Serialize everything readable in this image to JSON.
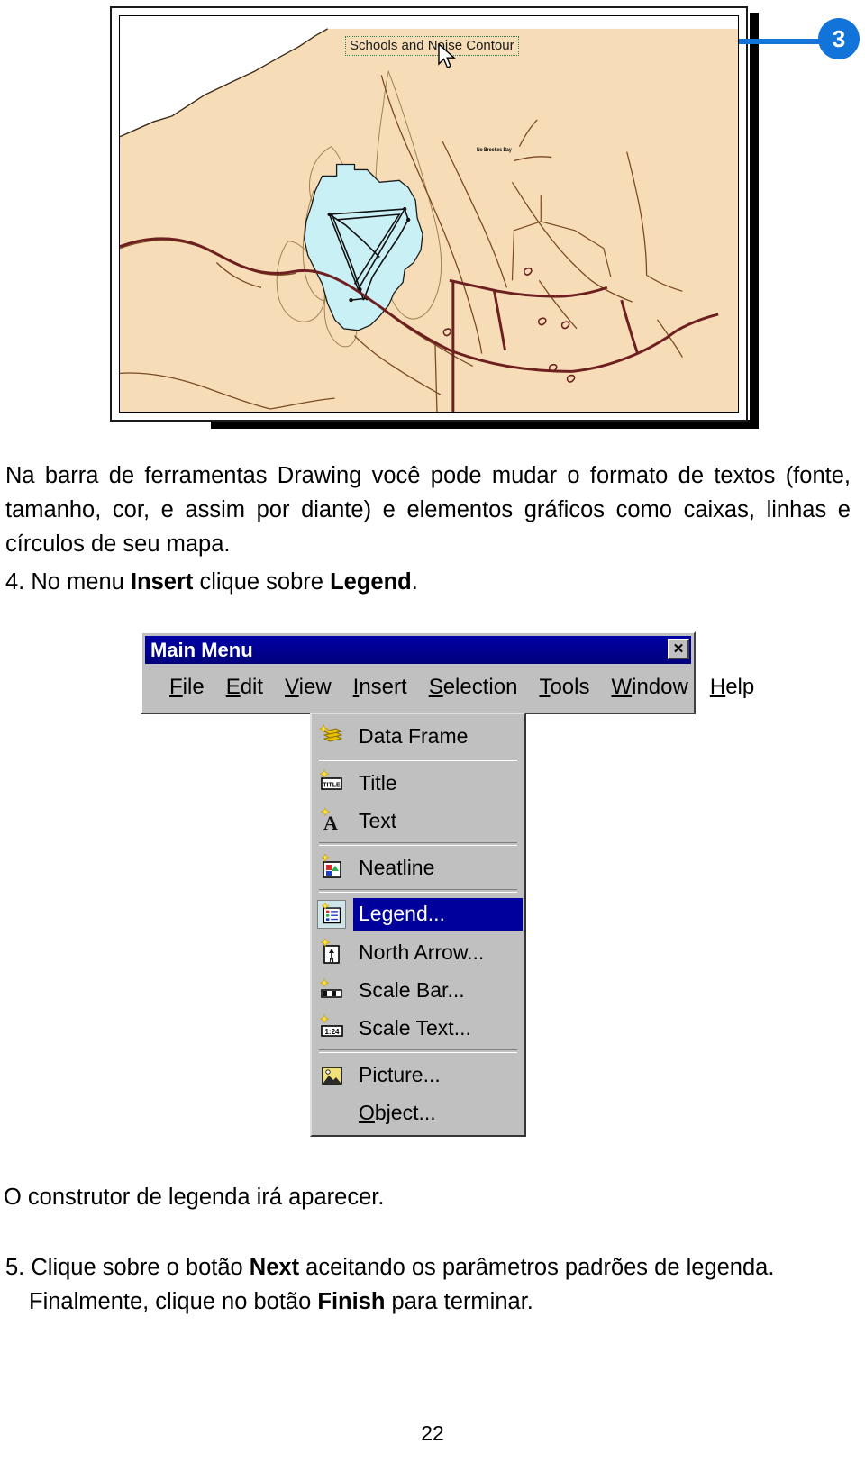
{
  "figure": {
    "map_title": "Schools and Noise Contour",
    "place_label": "No Brookes Bay",
    "callout_number": "3",
    "colors": {
      "land": "#f6ddb8",
      "noise_polygon": "#c9f0f5",
      "road_major": "#7a2020",
      "road_minor": "#8a5a3a",
      "callout_blue": "#1273d8",
      "title_box_border": "#2e7d4f"
    }
  },
  "body": {
    "intro_paragraph_lines": [
      "Na barra de ferramentas Drawing você pode mudar o formato de textos",
      "(fonte, tamanho, cor, e assim por diante) e elementos gráficos como caixas,",
      "linhas e círculos de seu mapa."
    ],
    "step_4": {
      "number": "4.",
      "text_before": "No menu ",
      "bold_1": "Insert",
      "text_middle": " clique sobre ",
      "bold_2": "Legend",
      "text_after": "."
    },
    "constructor_line": "O construtor de legenda irá aparecer.",
    "step_5": {
      "number": "5.",
      "text_1": "Clique sobre o botão ",
      "bold_1": "Next",
      "text_2": " aceitando os parâmetros padrões de legenda.",
      "text_3": "Finalmente, clique no botão ",
      "bold_2": "Finish",
      "text_4": " para terminar."
    },
    "page_number": "22"
  },
  "menu_window": {
    "title": "Main Menu",
    "close_label": "✕",
    "menubar": [
      {
        "name": "file",
        "pre": "",
        "mnemonic": "F",
        "post": "ile"
      },
      {
        "name": "edit",
        "pre": "",
        "mnemonic": "E",
        "post": "dit"
      },
      {
        "name": "view",
        "pre": "",
        "mnemonic": "V",
        "post": "iew"
      },
      {
        "name": "insert",
        "pre": "",
        "mnemonic": "I",
        "post": "nsert"
      },
      {
        "name": "selection",
        "pre": "",
        "mnemonic": "S",
        "post": "election"
      },
      {
        "name": "tools",
        "pre": "",
        "mnemonic": "T",
        "post": "ools"
      },
      {
        "name": "window",
        "pre": "",
        "mnemonic": "W",
        "post": "indow"
      },
      {
        "name": "help",
        "pre": "",
        "mnemonic": "H",
        "post": "elp"
      }
    ]
  },
  "insert_menu": {
    "items": [
      {
        "label": "Data Frame",
        "icon": "data-frame-icon",
        "selected": false,
        "separator_after": true
      },
      {
        "label": "Title",
        "icon": "title-icon",
        "selected": false,
        "separator_after": false
      },
      {
        "label": "Text",
        "icon": "text-icon",
        "selected": false,
        "separator_after": true
      },
      {
        "label": "Neatline",
        "icon": "neatline-icon",
        "selected": false,
        "separator_after": true
      },
      {
        "label": "Legend...",
        "icon": "legend-icon",
        "selected": true,
        "separator_after": false
      },
      {
        "label": "North Arrow...",
        "icon": "north-arrow-icon",
        "selected": false,
        "separator_after": false
      },
      {
        "label": "Scale Bar...",
        "icon": "scale-bar-icon",
        "selected": false,
        "separator_after": false
      },
      {
        "label": "Scale Text...",
        "icon": "scale-text-icon",
        "selected": false,
        "separator_after": true
      },
      {
        "label": "Picture...",
        "icon": "picture-icon",
        "selected": false,
        "separator_after": false
      },
      {
        "label": "Object...",
        "icon": "object-icon",
        "selected": false,
        "separator_after": false
      }
    ],
    "highlight_color": "#00009c",
    "highlight_text_color": "#ffffff"
  }
}
